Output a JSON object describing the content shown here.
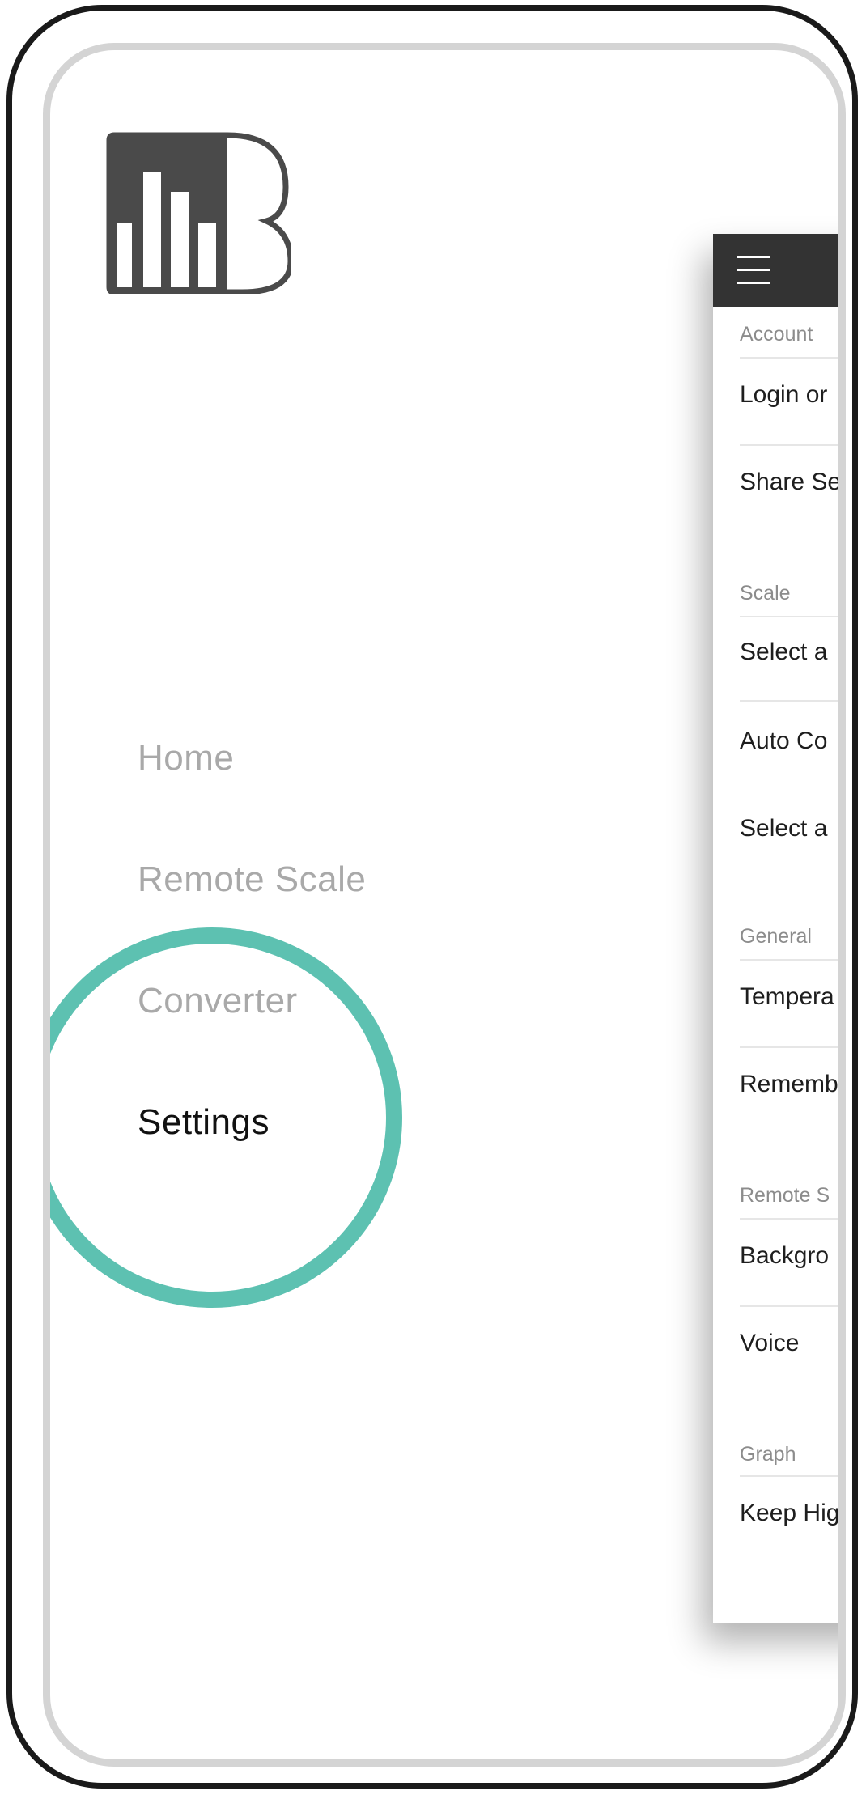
{
  "sidebar": {
    "items": [
      {
        "label": "Home",
        "active": false
      },
      {
        "label": "Remote Scale",
        "active": false
      },
      {
        "label": "Converter",
        "active": false
      },
      {
        "label": "Settings",
        "active": true
      }
    ]
  },
  "settings_panel": {
    "sections": {
      "account": {
        "label": "Account",
        "items": [
          "Login or",
          "Share Se"
        ]
      },
      "scale": {
        "label": "Scale",
        "items": [
          "Select a",
          "Auto Co",
          "Select a"
        ]
      },
      "general": {
        "label": "General",
        "items": [
          "Tempera",
          "Rememb"
        ]
      },
      "remote": {
        "label": "Remote S",
        "items": [
          "Backgro",
          "Voice"
        ]
      },
      "graph": {
        "label": "Graph",
        "items": [
          "Keep Hig"
        ]
      }
    }
  },
  "colors": {
    "highlight_ring": "#5dc1b1",
    "panel_header": "#333333",
    "menu_inactive": "#a9a9a9",
    "menu_active": "#111111",
    "logo": "#4a4a4a"
  },
  "icons": {
    "logo": "bar-chart-b-logo",
    "menu": "hamburger-icon"
  }
}
